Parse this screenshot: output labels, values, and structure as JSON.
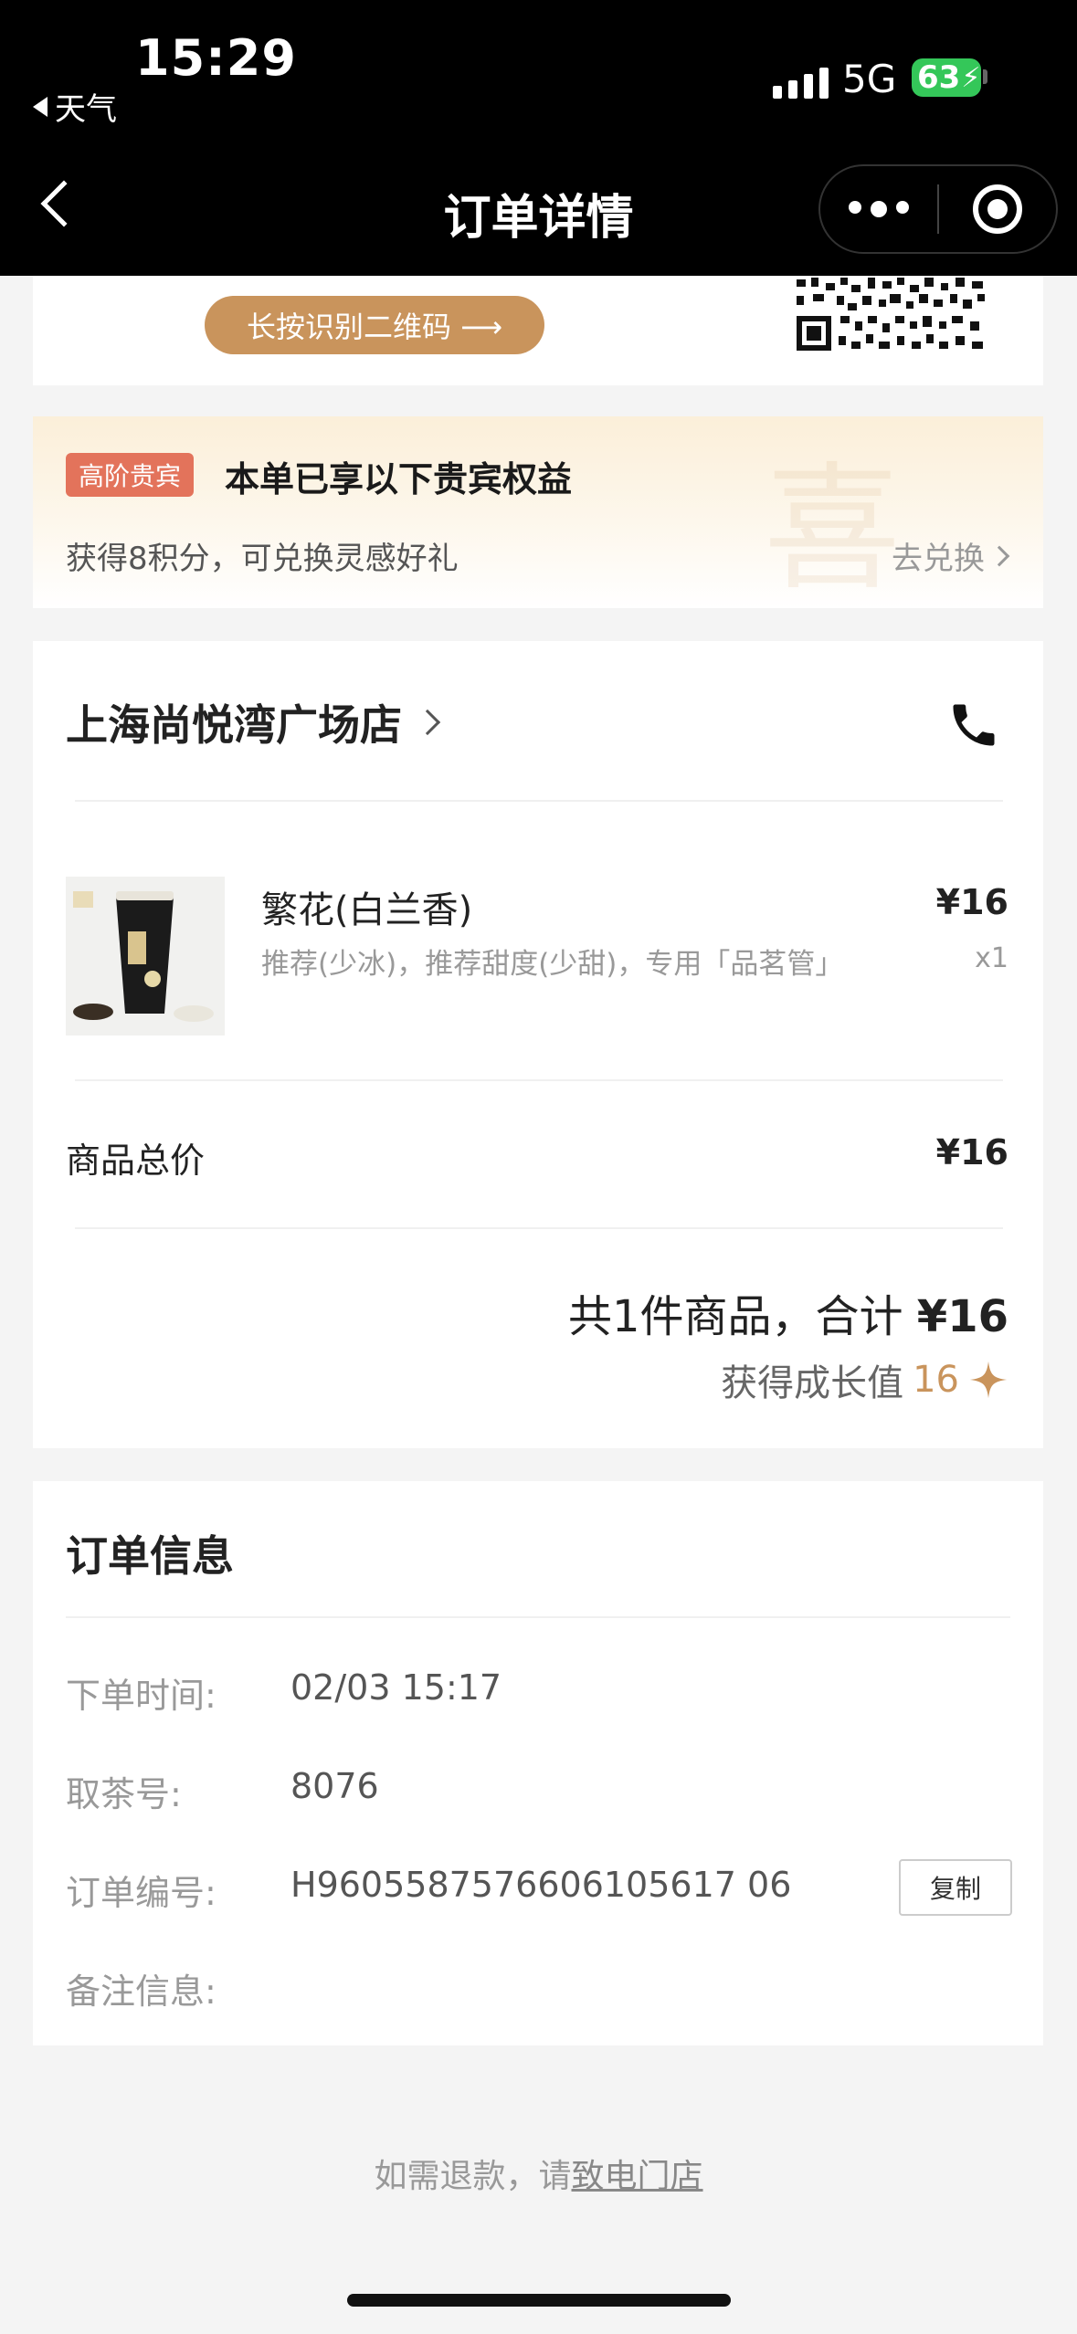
{
  "status_bar": {
    "time": "15:29",
    "back_app": "天气",
    "network": "5G",
    "battery": "63"
  },
  "nav": {
    "title": "订单详情"
  },
  "qr": {
    "button_label": "长按识别二维码 ⟶"
  },
  "vip": {
    "badge": "高阶贵宾",
    "title": "本单已享以下贵宾权益",
    "subtitle": "获得8积分，可兑换灵感好礼",
    "link": "去兑换",
    "seal_text": "喜"
  },
  "store": {
    "name": "上海尚悦湾广场店"
  },
  "product": {
    "name": "繁花(白兰香)",
    "desc": "推荐(少冰)，推荐甜度(少甜)，专用「品茗管」",
    "price": "¥16",
    "qty": "x1"
  },
  "summary": {
    "subtotal_label": "商品总价",
    "subtotal_value": "¥16",
    "total_prefix": "共1件商品，合计",
    "total_value": "¥16",
    "growth_label": "获得成长值",
    "growth_value": "16"
  },
  "order_info": {
    "title": "订单信息",
    "rows": [
      {
        "label": "下单时间:",
        "value": "02/03 15:17"
      },
      {
        "label": "取茶号:",
        "value": "8076"
      },
      {
        "label": "订单编号:",
        "value": "H9605587576606105617 06"
      },
      {
        "label": "备注信息:",
        "value": ""
      }
    ],
    "copy_label": "复制"
  },
  "footer": {
    "prefix": "如需退款，请",
    "link": "致电门店"
  },
  "colors": {
    "accent": "#c9945c",
    "badge": "#e3735b",
    "battery": "#34c759"
  }
}
